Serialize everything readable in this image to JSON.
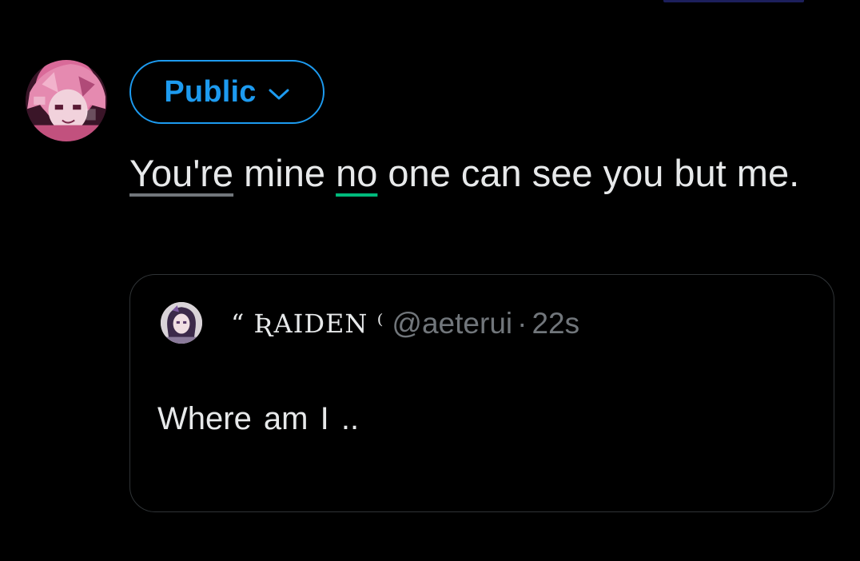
{
  "composer": {
    "audience_label": "Public",
    "text_part1": "You're",
    "text_part2": " mine ",
    "text_part3": "no",
    "text_part4": " one can see you but me."
  },
  "quoted_post": {
    "display_name": "“ ƦAIDEN ⁽",
    "handle": "@aeterui",
    "separator": "·",
    "time": "22s",
    "body": "Where  am  I  .."
  },
  "icons": {
    "audience_chevron": "chevron-down-icon"
  },
  "colors": {
    "accent": "#1d9bf0",
    "muted": "#71767b",
    "underline_gray": "#71767b",
    "underline_green": "#00ba7c",
    "card_border": "#2f3336"
  }
}
